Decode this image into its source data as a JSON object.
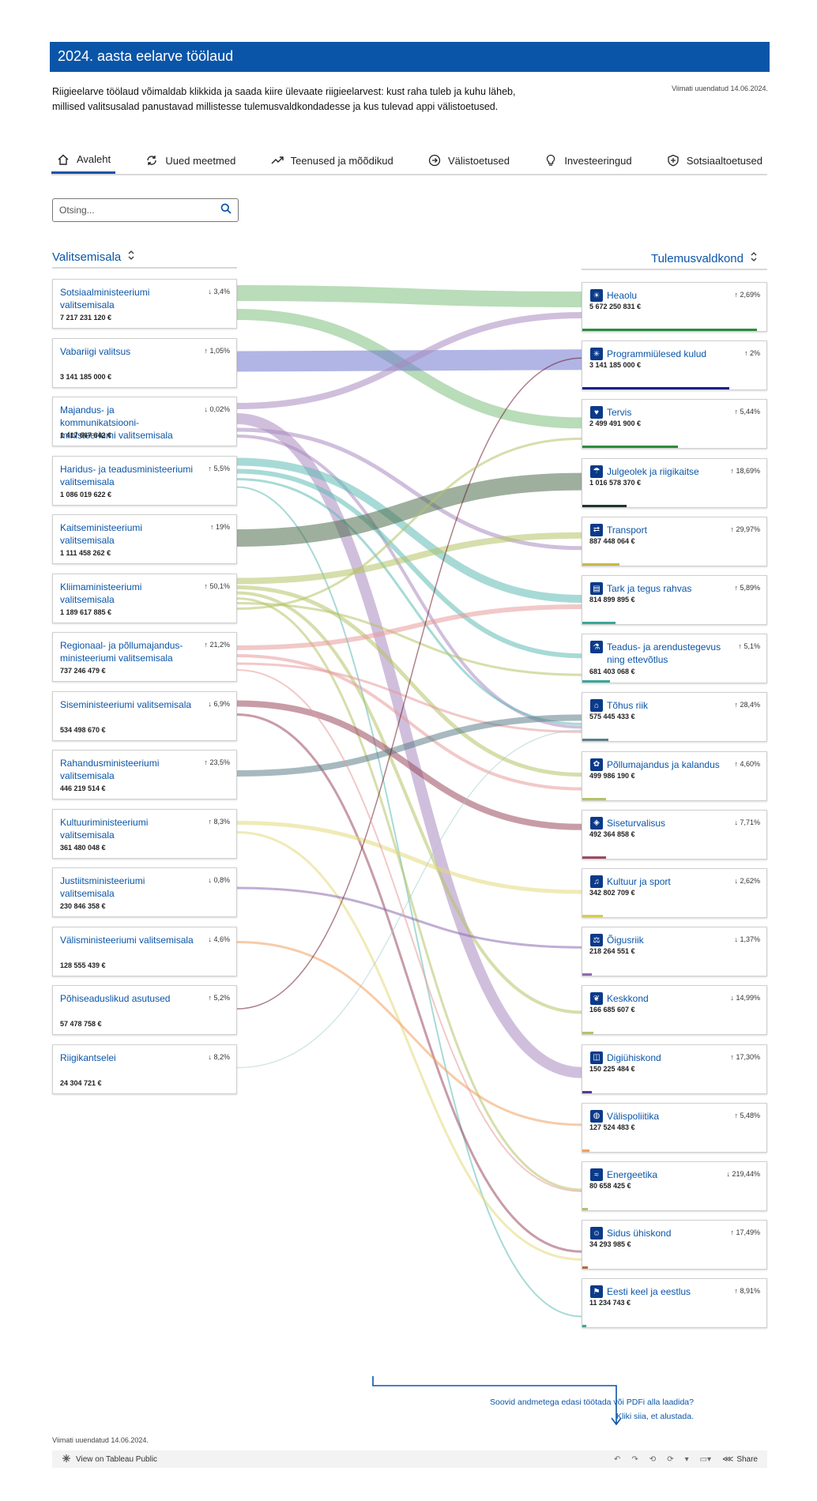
{
  "header": {
    "title": "2024. aasta eelarve töölaud"
  },
  "intro": {
    "line1": "Riigieelarve töölaud võimaldab klikkida ja saada kiire ülevaate riigieelarvest: kust raha tuleb ja kuhu läheb,",
    "line2": "millised valitsusalad panustavad millistesse tulemusvaldkondadesse ja kus tulevad appi välistoetused."
  },
  "updated_top": "Viimati uuendatud 14.06.2024.",
  "tabs": [
    {
      "label": "Avaleht",
      "icon": "home-icon"
    },
    {
      "label": "Uued meetmed",
      "icon": "refresh-icon"
    },
    {
      "label": "Teenused ja mõõdikud",
      "icon": "trend-icon"
    },
    {
      "label": "Välistoetused",
      "icon": "arrow-circle-icon"
    },
    {
      "label": "Investeeringud",
      "icon": "lightbulb-icon"
    },
    {
      "label": "Sotsiaaltoetused",
      "icon": "shield-icon"
    }
  ],
  "search": {
    "placeholder": "Otsing..."
  },
  "left_header": {
    "label": "Valitsemisala"
  },
  "right_header": {
    "label": "Tulemusvaldkond"
  },
  "ministries": [
    {
      "name": "Sotsiaalministeeriumi valitsemisala",
      "amount": "7 217 231 120 €",
      "change": "↓ 3,4%",
      "color": "#7fbf7f"
    },
    {
      "name": "Vabariigi valitsus",
      "amount": "3 141 185 000 €",
      "change": "↑ 1,05%",
      "color": "#6f79cf"
    },
    {
      "name": "Majandus- ja kommunikatsiooni-ministeeriumi valitsemisala",
      "amount": "1 417 667 642 €",
      "change": "↓ 0,02%",
      "color": "#a98abf"
    },
    {
      "name": "Haridus- ja teadusministeeriumi valitsemisala",
      "amount": "1 086 019 622 €",
      "change": "↑ 5,5%",
      "color": "#5fbcb4"
    },
    {
      "name": "Kaitseministeeriumi valitsemisala",
      "amount": "1 111 458 262 €",
      "change": "↑ 19%",
      "color": "#4e6e4e"
    },
    {
      "name": "Kliimaministeeriumi valitsemisala",
      "amount": "1 189 617 885 €",
      "change": "↑ 50,1%",
      "color": "#b5c266"
    },
    {
      "name": "Regionaal- ja põllumajandus-ministeeriumi valitsemisala",
      "amount": "737 246 479 €",
      "change": "↑ 21,2%",
      "color": "#e89a9a"
    },
    {
      "name": "Siseministeeriumi valitsemisala",
      "amount": "534 498 670 €",
      "change": "↓ 6,9%",
      "color": "#9a4a5e"
    },
    {
      "name": "Rahandusministeeriumi valitsemisala",
      "amount": "446 219 514 €",
      "change": "↑ 23,5%",
      "color": "#5e7f8a"
    },
    {
      "name": "Kultuuriministeeriumi valitsemisala",
      "amount": "361 480 048 €",
      "change": "↑ 8,3%",
      "color": "#e3d97a"
    },
    {
      "name": "Justiitsministeeriumi valitsemisala",
      "amount": "230 846 358 €",
      "change": "↓ 0,8%",
      "color": "#8e6ab0"
    },
    {
      "name": "Välisministeeriumi valitsemisala",
      "amount": "128 555 439 €",
      "change": "↓ 4,6%",
      "color": "#f0a060"
    },
    {
      "name": "Põhiseaduslikud asutused",
      "amount": "57 478 758 €",
      "change": "↑ 5,2%",
      "color": "#6b1a2a"
    },
    {
      "name": "Riigikantselei",
      "amount": "24 304 721 €",
      "change": "↓ 8,2%",
      "color": "#9cc8c8"
    }
  ],
  "areas": [
    {
      "name": "Heaolu",
      "amount": "5 672 250 831 €",
      "change": "↑ 2,69%",
      "icon": "sun-icon",
      "bar_color": "#2e8b3e",
      "bar_fill": 0.95
    },
    {
      "name": "Programmiülesed kulud",
      "amount": "3 141 185 000 €",
      "change": "↑ 2%",
      "icon": "snowflake-icon",
      "bar_color": "#1a1f8a",
      "bar_fill": 0.8
    },
    {
      "name": "Tervis",
      "amount": "2 499 491 900 €",
      "change": "↑ 5,44%",
      "icon": "health-icon",
      "bar_color": "#2e8b3e",
      "bar_fill": 0.52
    },
    {
      "name": "Julgeolek ja riigikaitse",
      "amount": "1 016 578 370 €",
      "change": "↑ 18,69%",
      "icon": "umbrella-icon",
      "bar_color": "#22332a",
      "bar_fill": 0.24
    },
    {
      "name": "Transport",
      "amount": "887 448 064 €",
      "change": "↑ 29,97%",
      "icon": "transport-icon",
      "bar_color": "#c8b84a",
      "bar_fill": 0.2
    },
    {
      "name": "Tark ja tegus rahvas",
      "amount": "814 899 895 €",
      "change": "↑ 5,89%",
      "icon": "book-icon",
      "bar_color": "#3aa79a",
      "bar_fill": 0.18
    },
    {
      "name": "Teadus- ja arendustegevus ning ettevõtlus",
      "amount": "681 403 068 €",
      "change": "↑ 5,1%",
      "icon": "flask-icon",
      "bar_color": "#3aa79a",
      "bar_fill": 0.15
    },
    {
      "name": "Tõhus riik",
      "amount": "575 445 433 €",
      "change": "↑ 28,4%",
      "icon": "building-icon",
      "bar_color": "#5e7f8a",
      "bar_fill": 0.14
    },
    {
      "name": "Põllumajandus ja kalandus",
      "amount": "499 986 190 €",
      "change": "↑ 4,60%",
      "icon": "wheat-icon",
      "bar_color": "#b5c266",
      "bar_fill": 0.13
    },
    {
      "name": "Siseturvalisus",
      "amount": "492 364 858 €",
      "change": "↓ 7,71%",
      "icon": "shield-small-icon",
      "bar_color": "#9a4a5e",
      "bar_fill": 0.13
    },
    {
      "name": "Kultuur ja sport",
      "amount": "342 802 709 €",
      "change": "↓ 2,62%",
      "icon": "culture-icon",
      "bar_color": "#d9cc50",
      "bar_fill": 0.11
    },
    {
      "name": "Õigusriik",
      "amount": "218 264 551 €",
      "change": "↓ 1,37%",
      "icon": "scales-icon",
      "bar_color": "#8e6ab0",
      "bar_fill": 0.05
    },
    {
      "name": "Keskkond",
      "amount": "166 685 607 €",
      "change": "↓ 14,99%",
      "icon": "leaf-icon",
      "bar_color": "#b5c266",
      "bar_fill": 0.06
    },
    {
      "name": "Digiühiskond",
      "amount": "150 225 484 €",
      "change": "↑ 17,30%",
      "icon": "digital-icon",
      "bar_color": "#5a3a8a",
      "bar_fill": 0.05
    },
    {
      "name": "Välispoliitika",
      "amount": "127 524 483 €",
      "change": "↑ 5,48%",
      "icon": "globe-icon",
      "bar_color": "#f0a060",
      "bar_fill": 0.04
    },
    {
      "name": "Energeetika",
      "amount": "80 658 425 €",
      "change": "↓ 219,44%",
      "icon": "energy-icon",
      "bar_color": "#b5c266",
      "bar_fill": 0.03
    },
    {
      "name": "Sidus ühiskond",
      "amount": "34 293 985 €",
      "change": "↑ 17,49%",
      "icon": "people-icon",
      "bar_color": "#b96a3a",
      "bar_fill": 0.03
    },
    {
      "name": "Eesti keel ja eestlus",
      "amount": "11 234 743 €",
      "change": "↑ 8,91%",
      "icon": "flag-icon",
      "bar_color": "#3aa79a",
      "bar_fill": 0.02
    }
  ],
  "footer": {
    "cta_line1": "Soovid andmetega edasi töötada või PDFi alla laadida?",
    "cta_line2": "Kliki siia, et alustada.",
    "updated_bottom": "Viimati uuendatud 14.06.2024.",
    "view_on": "View on Tableau Public",
    "share": "Share"
  },
  "colors": {
    "brand": "#0b55a8"
  }
}
